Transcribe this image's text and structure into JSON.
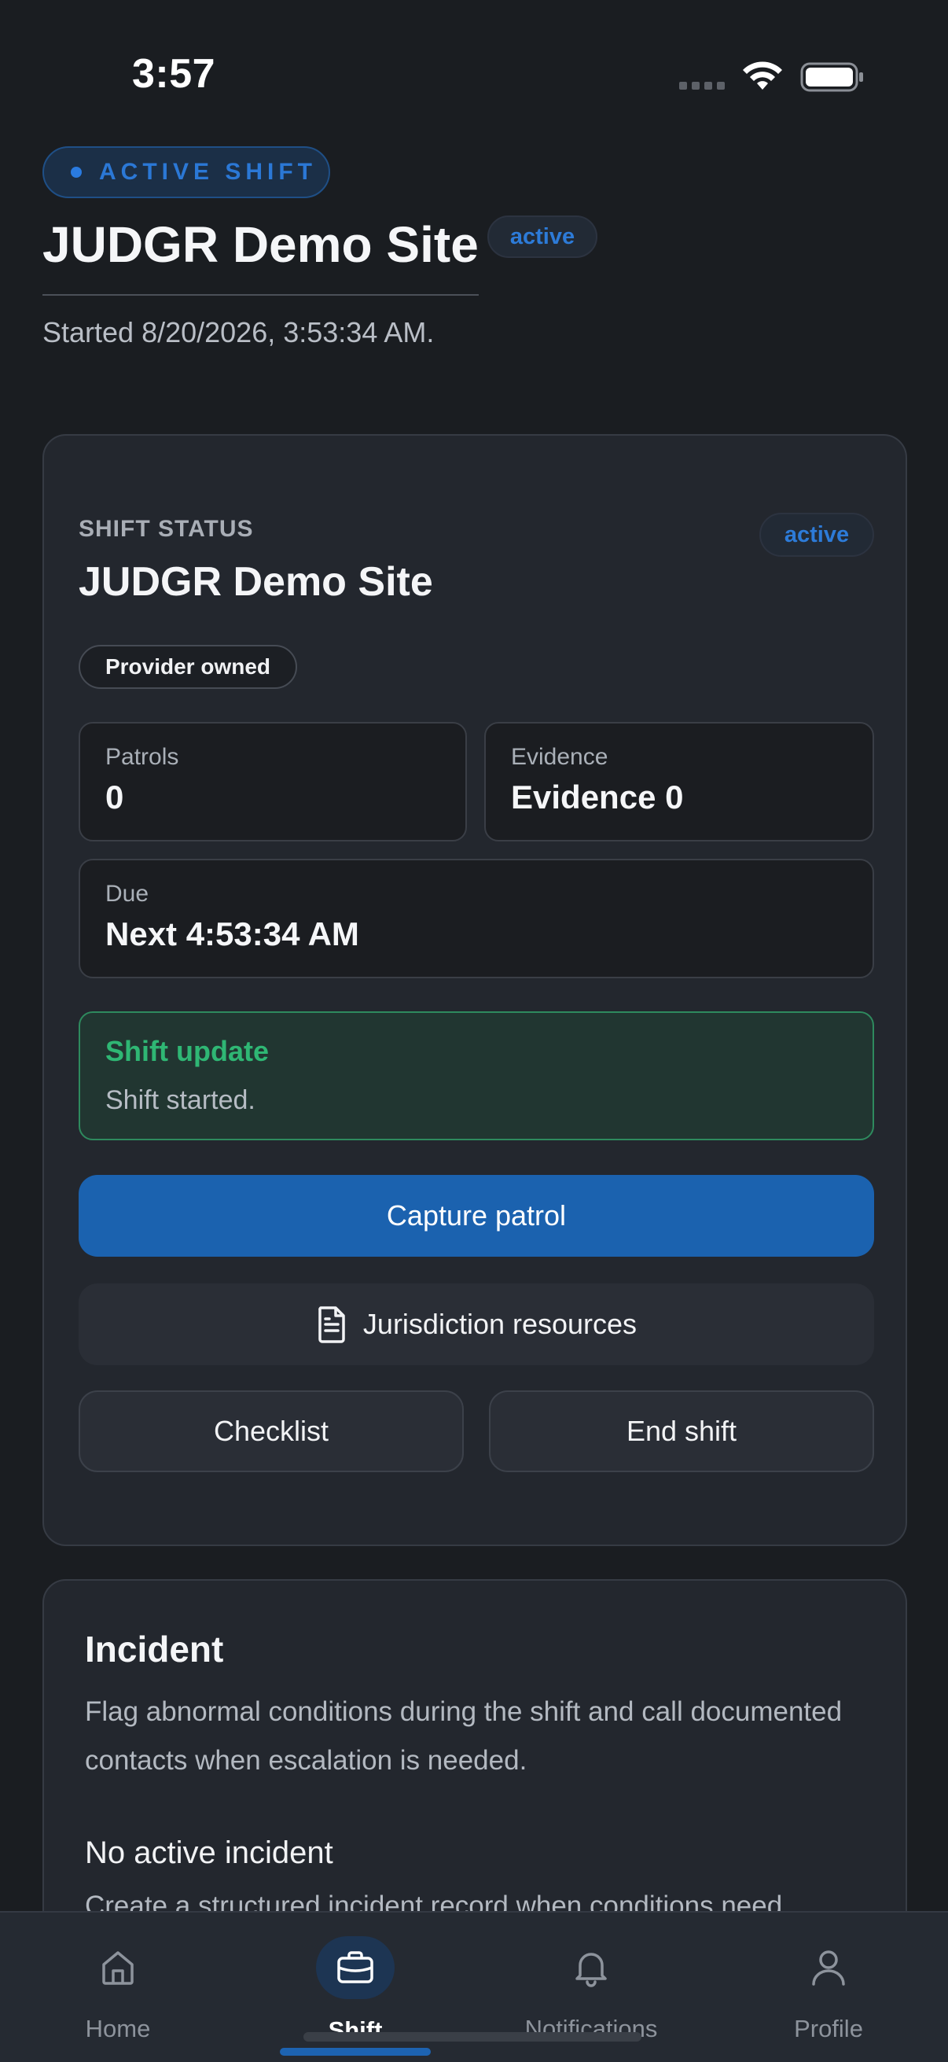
{
  "status_bar": {
    "time": "3:57"
  },
  "header": {
    "pill_label": "ACTIVE SHIFT",
    "title": "JUDGR Demo Site",
    "badge": "active",
    "started": "Started 8/20/2026, 3:53:34 AM."
  },
  "shift_card": {
    "section_label": "SHIFT STATUS",
    "title": "JUDGR Demo Site",
    "badge": "active",
    "owner_chip": "Provider owned",
    "stats": {
      "patrols_label": "Patrols",
      "patrols_value": "0",
      "evidence_label": "Evidence",
      "evidence_value": "Evidence 0",
      "due_label": "Due",
      "due_value": "Next 4:53:34 AM"
    },
    "update": {
      "title": "Shift update",
      "text": "Shift started."
    },
    "buttons": {
      "capture": "Capture patrol",
      "resources": "Jurisdiction resources",
      "checklist": "Checklist",
      "end": "End shift"
    }
  },
  "incident_card": {
    "title": "Incident",
    "description": "Flag abnormal conditions during the shift and call documented contacts when escalation is needed.",
    "subtitle": "No active incident",
    "subtext": "Create a structured incident record when conditions need"
  },
  "tab_bar": {
    "home": "Home",
    "shift": "Shift",
    "notifications": "Notifications",
    "profile": "Profile",
    "active_tab": "Shift"
  },
  "colors": {
    "background": "#1a1d21",
    "card": "#23272e",
    "accent_blue": "#1b62af",
    "success_green": "#2fb774"
  }
}
